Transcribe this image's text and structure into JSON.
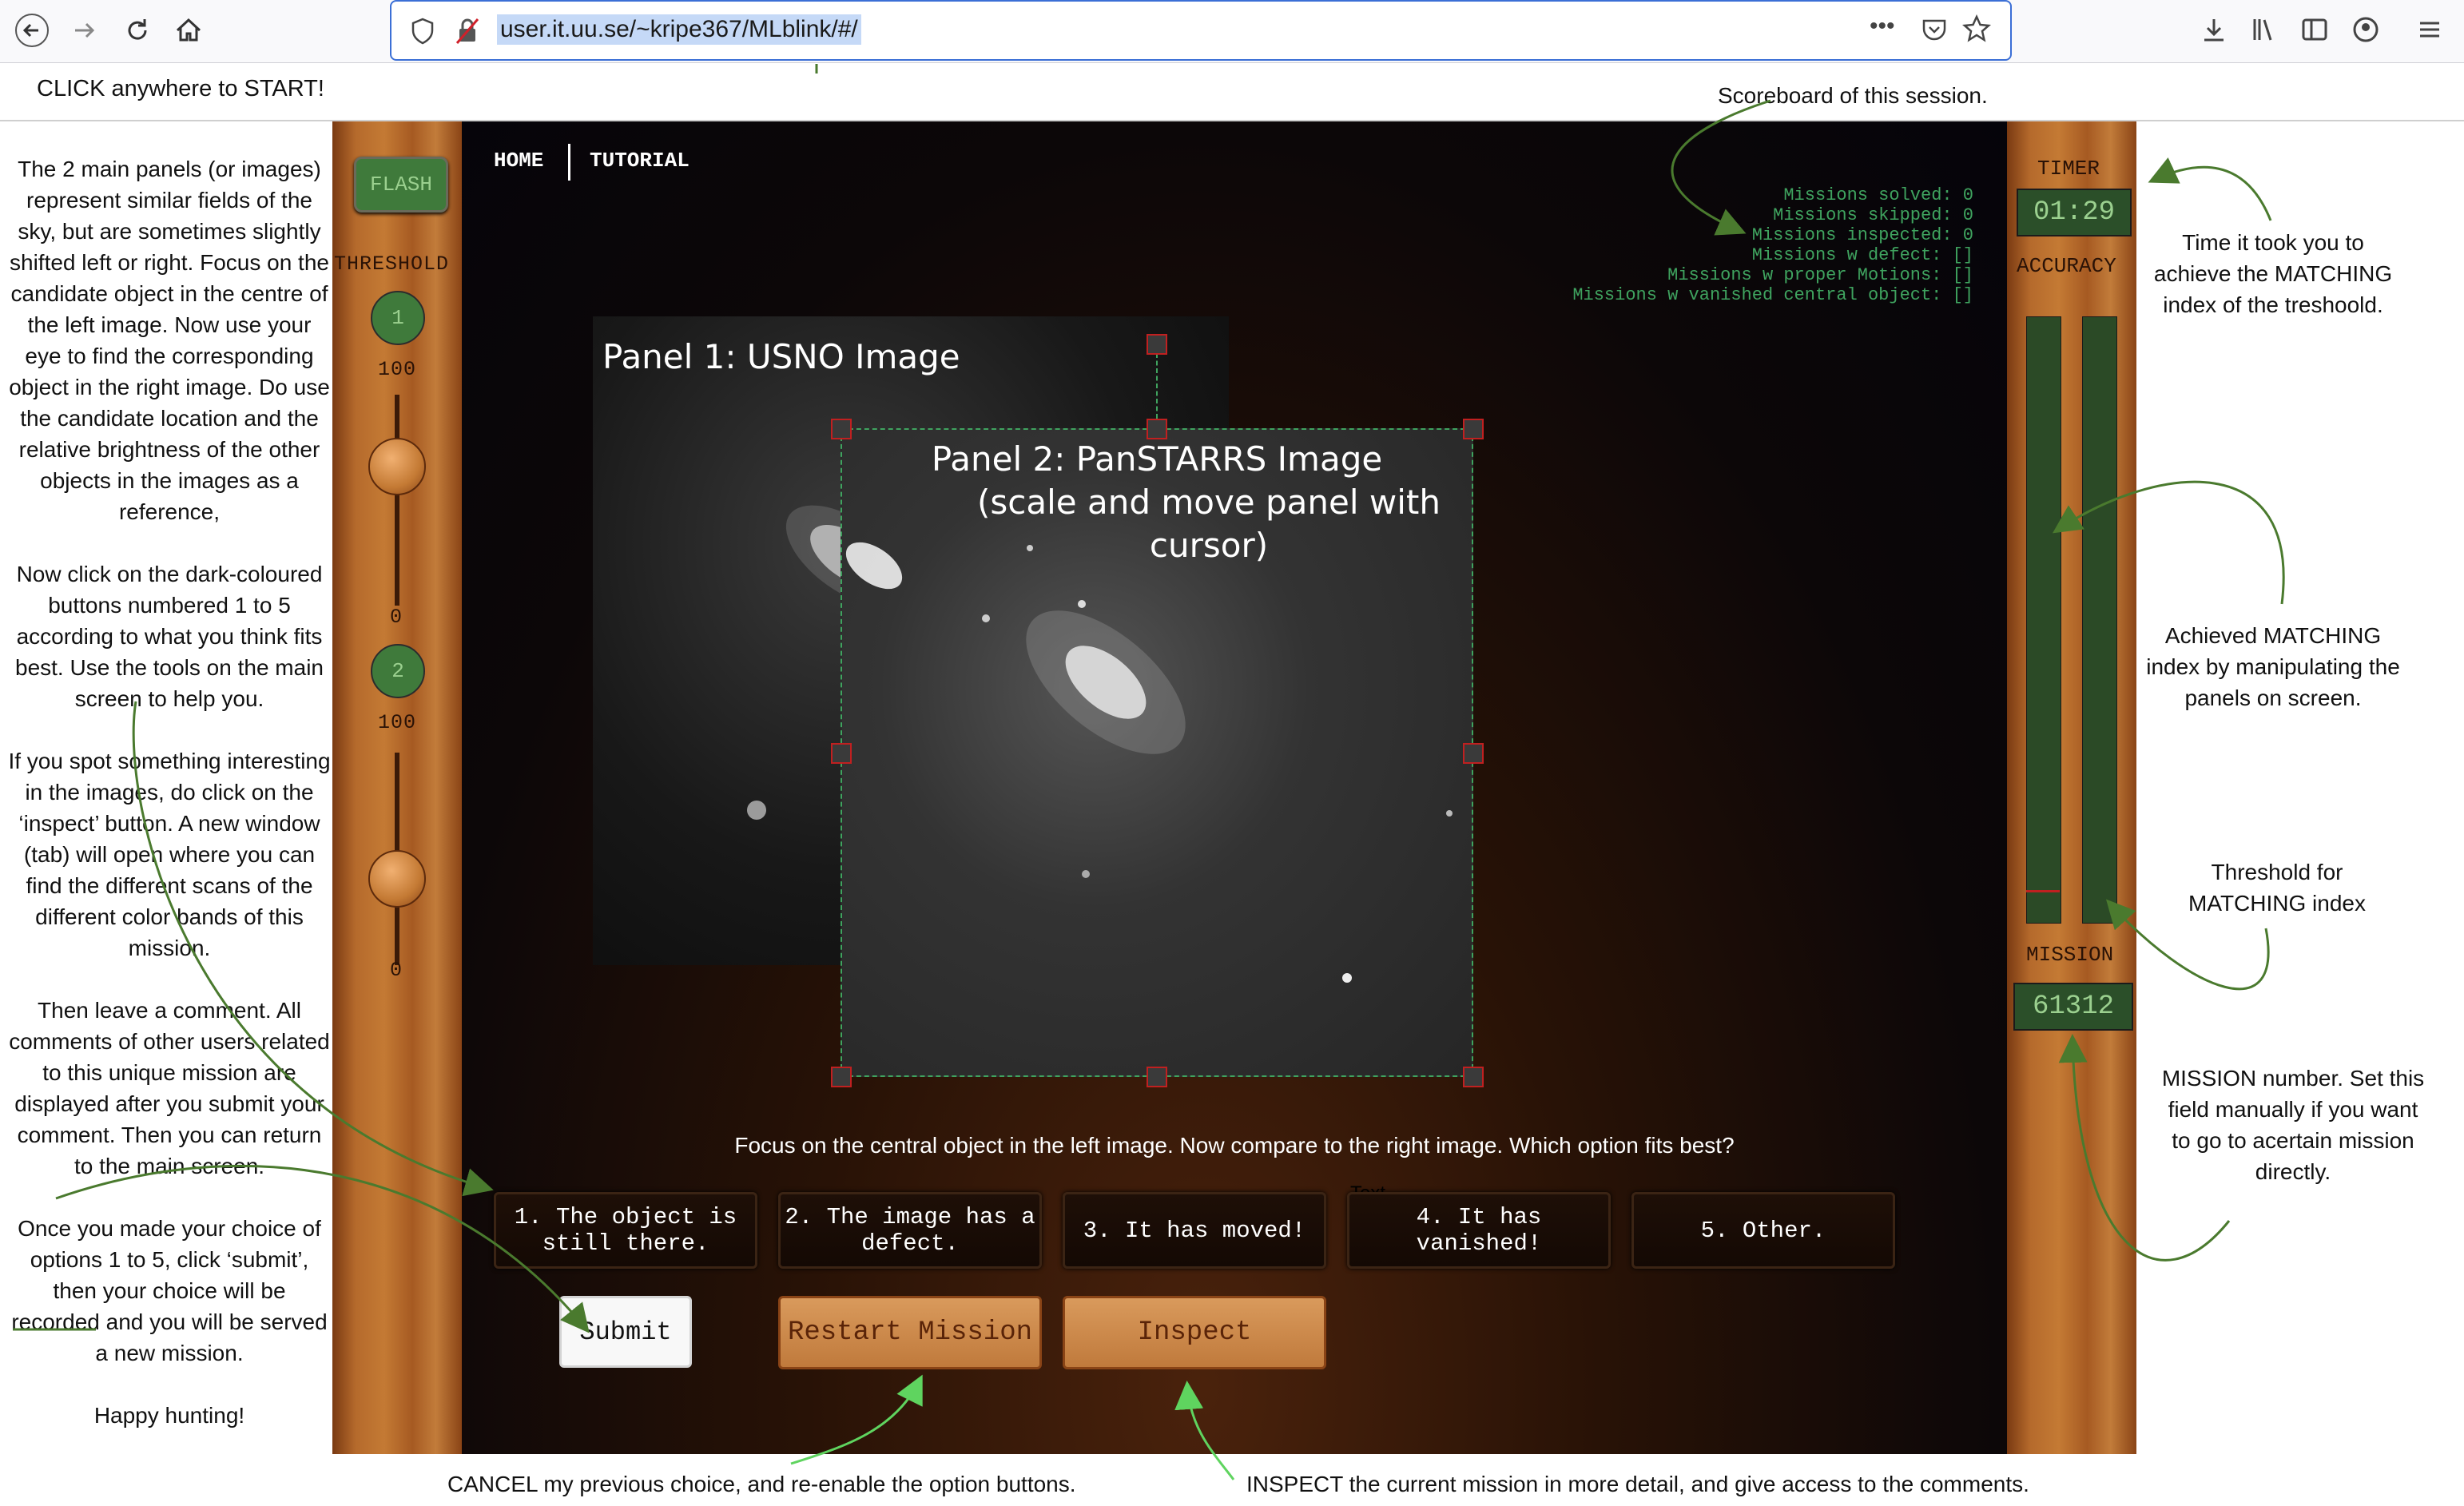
{
  "browser": {
    "url": "user.it.uu.se/~kripe367/MLblink/#/"
  },
  "annotations": {
    "click_start": "CLICK anywhere to START!",
    "left_paragraphs": [
      "The 2 main panels (or images) represent similar fields of the sky, but are sometimes slightly shifted left or right. Focus on the candidate object in the centre of the left image. Now use your eye to find the corresponding object in the right image. Do use the candidate location and the relative brightness of the other objects in the images as a reference,",
      "Now click on the dark-coloured buttons numbered 1 to 5 according to what you think fits best. Use the tools on the main screen to help you.",
      "If you spot something interesting in the images, do click on the ‘inspect’ button. A new window (tab) will open where you can find the different scans of the different color bands of this mission.",
      "Then leave a comment.  All comments of other users related to this unique mission are displayed after you submit your comment. Then you can return to the main screen.",
      "Once you made your choice of options 1 to 5, click ‘submit’, then your choice will be recorded and you will be served a new mission.",
      "Happy hunting!"
    ],
    "scoreboard": "Scoreboard of this session.",
    "timer_note": "Time it took you to achieve the MATCHING index of the treshoold.",
    "matching_note": "Achieved MATCHING index by manipulating the panels on screen.",
    "threshold_note": "Threshold for MATCHING index",
    "mission_note": "MISSION number. Set this field manually if you want to go to acertain mission directly.",
    "cancel_note": "CANCEL my previous choice, and re-enable the option buttons.",
    "inspect_note": "INSPECT the current mission in more detail, and give access to the comments."
  },
  "app": {
    "flash_label": "FLASH",
    "threshold_label": "THRESHOLD",
    "slider1": {
      "number": "1",
      "max": "100",
      "min": "0"
    },
    "slider2": {
      "number": "2",
      "max": "100",
      "min": "0"
    },
    "nav": {
      "home": "HOME",
      "tutorial": "TUTORIAL"
    },
    "scores": [
      "Missions solved: 0",
      "Missions skipped: 0",
      "Missions inspected: 0",
      "Missions w defect: []",
      "Missions w proper Motions: []",
      "Missions w vanished central object: []"
    ],
    "panel1_title": "Panel 1: USNO Image",
    "panel2_title_line1": "Panel 2: PanSTARRS Image",
    "panel2_title_line2": "(scale and move panel with cursor)",
    "timer_label": "TIMER",
    "timer_value": "01:29",
    "accuracy_label": "ACCURACY",
    "mission_label": "MISSION",
    "mission_value": "61312",
    "question": "Focus on the central object in the left image. Now compare to the right image. Which option fits best?",
    "stray_text": "Text",
    "options": [
      "1. The object is still there.",
      "2. The image has a defect.",
      "3. It has moved!",
      "4. It has vanished!",
      "5. Other."
    ],
    "submit_label": "Submit",
    "restart_label": "Restart Mission",
    "inspect_label": "Inspect"
  },
  "colors": {
    "accent_green": "#3fa35f",
    "wood": "#c47a34",
    "button_green": "#3f7a3b"
  }
}
